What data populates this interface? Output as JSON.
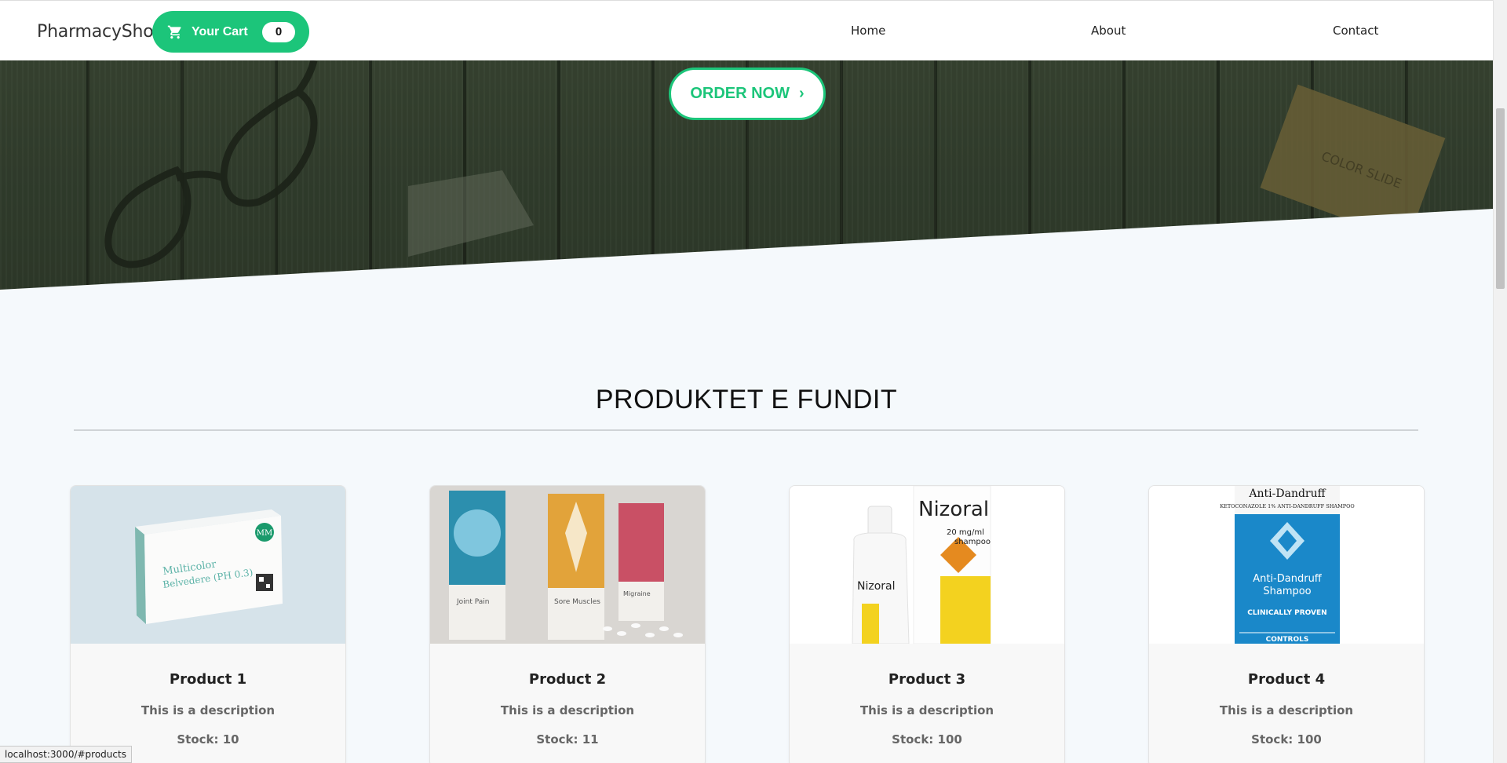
{
  "navbar": {
    "brand": "PharmacyShop",
    "cart": {
      "label": "Your Cart",
      "count": "0"
    },
    "links": [
      "Home",
      "About",
      "Contact"
    ]
  },
  "hero": {
    "order_button": "ORDER NOW",
    "order_chevron": "›"
  },
  "section": {
    "title": "PRODUKTET E FUNDIT"
  },
  "products": [
    {
      "title": "Product 1",
      "description": "This is a description",
      "stock": "Stock: 10",
      "image": {
        "box_line1": "Multicolor",
        "box_line2": "Belvedere (PH 0.3)",
        "logo": "MM"
      }
    },
    {
      "title": "Product 2",
      "description": "This is a description",
      "stock": "Stock: 11",
      "image": {
        "box1": "Joint Pain",
        "box2": "Sore Muscles",
        "box3": "Migraine"
      }
    },
    {
      "title": "Product 3",
      "description": "This is a description",
      "stock": "Stock: 100",
      "image": {
        "brand": "Nizoral",
        "dose": "20 mg/ml",
        "kind": "shampoo",
        "bottle_brand": "Nizoral"
      }
    },
    {
      "title": "Product 4",
      "description": "This is a description",
      "stock": "Stock: 100",
      "image": {
        "top": "Anti-Dandruff",
        "sub": "KETOCONAZOLE 1% ANTI-DANDRUFF SHAMPOO",
        "mid1": "Anti-Dandruff",
        "mid2": "Shampoo",
        "claim": "CLINICALLY PROVEN",
        "bottom": "CONTROLS"
      }
    }
  ],
  "status_bar": "localhost:3000/#products",
  "colors": {
    "accent": "#1cc57a",
    "page_bg": "#f5f9fc"
  }
}
